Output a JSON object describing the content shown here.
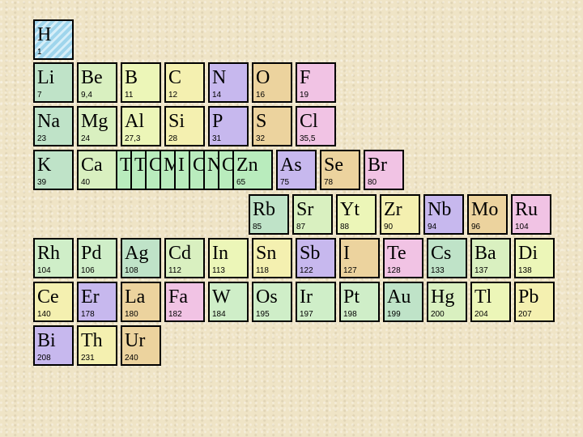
{
  "colors": {
    "hydrogen": "#b9e1f2",
    "alkali": "#bfe3c8",
    "alkaline_earth": "#d9f0c0",
    "triad": "#cfeec8",
    "boron_group": "#ecf6b8",
    "carbon_group": "#f4f0b0",
    "nitrogen_group": "#c7b8ee",
    "oxygen_group": "#ecd39e",
    "halogen": "#f1c3e4",
    "transition_stack": "#b9ecbd"
  },
  "hydrogen": {
    "symbol": "H",
    "number": "1"
  },
  "row2": [
    {
      "symbol": "Li",
      "number": "7"
    },
    {
      "symbol": "Be",
      "number": "9,4"
    },
    {
      "symbol": "B",
      "number": "11"
    },
    {
      "symbol": "C",
      "number": "12"
    },
    {
      "symbol": "N",
      "number": "14"
    },
    {
      "symbol": "O",
      "number": "16"
    },
    {
      "symbol": "F",
      "number": "19"
    }
  ],
  "row3": [
    {
      "symbol": "Na",
      "number": "23"
    },
    {
      "symbol": "Mg",
      "number": "24"
    },
    {
      "symbol": "Al",
      "number": "27,3"
    },
    {
      "symbol": "Si",
      "number": "28"
    },
    {
      "symbol": "P",
      "number": "31"
    },
    {
      "symbol": "S",
      "number": "32"
    },
    {
      "symbol": "Cl",
      "number": "35,5"
    }
  ],
  "row4": [
    {
      "symbol": "K",
      "number": "39"
    },
    {
      "symbol": "Ca",
      "number": "40"
    }
  ],
  "row4_stack": {
    "symbols": [
      "T",
      "T",
      "C",
      "M",
      "I",
      "C",
      "N",
      "C"
    ],
    "last": {
      "symbol": "Zn",
      "number": "65"
    }
  },
  "row4_tail": [
    {
      "symbol": "As",
      "number": "75"
    },
    {
      "symbol": "Se",
      "number": "78"
    },
    {
      "symbol": "Br",
      "number": "80"
    }
  ],
  "row5": [
    {
      "symbol": "Rb",
      "number": "85"
    },
    {
      "symbol": "Sr",
      "number": "87"
    },
    {
      "symbol": "Yt",
      "number": "88"
    },
    {
      "symbol": "Zr",
      "number": "90"
    },
    {
      "symbol": "Nb",
      "number": "94"
    },
    {
      "symbol": "Mo",
      "number": "96"
    },
    {
      "symbol": "Ru",
      "number": "104"
    }
  ],
  "row6": [
    {
      "symbol": "Rh",
      "number": "104"
    },
    {
      "symbol": "Pd",
      "number": "106"
    },
    {
      "symbol": "Ag",
      "number": "108"
    },
    {
      "symbol": "Cd",
      "number": "112"
    },
    {
      "symbol": "In",
      "number": "113"
    },
    {
      "symbol": "Sn",
      "number": "118"
    },
    {
      "symbol": "Sb",
      "number": "122"
    },
    {
      "symbol": "I",
      "number": "127"
    },
    {
      "symbol": "Te",
      "number": "128"
    },
    {
      "symbol": "Cs",
      "number": "133"
    },
    {
      "symbol": "Ba",
      "number": "137"
    },
    {
      "symbol": "Di",
      "number": "138"
    }
  ],
  "row7": [
    {
      "symbol": "Ce",
      "number": "140"
    },
    {
      "symbol": "Er",
      "number": "178"
    },
    {
      "symbol": "La",
      "number": "180"
    },
    {
      "symbol": "Fa",
      "number": "182"
    },
    {
      "symbol": "W",
      "number": "184"
    },
    {
      "symbol": "Os",
      "number": "195"
    },
    {
      "symbol": "Ir",
      "number": "197"
    },
    {
      "symbol": "Pt",
      "number": "198"
    },
    {
      "symbol": "Au",
      "number": "199"
    },
    {
      "symbol": "Hg",
      "number": "200"
    },
    {
      "symbol": "Tl",
      "number": "204"
    },
    {
      "symbol": "Pb",
      "number": "207"
    }
  ],
  "row8": [
    {
      "symbol": "Bi",
      "number": "208"
    },
    {
      "symbol": "Th",
      "number": "231"
    },
    {
      "symbol": "Ur",
      "number": "240"
    }
  ]
}
